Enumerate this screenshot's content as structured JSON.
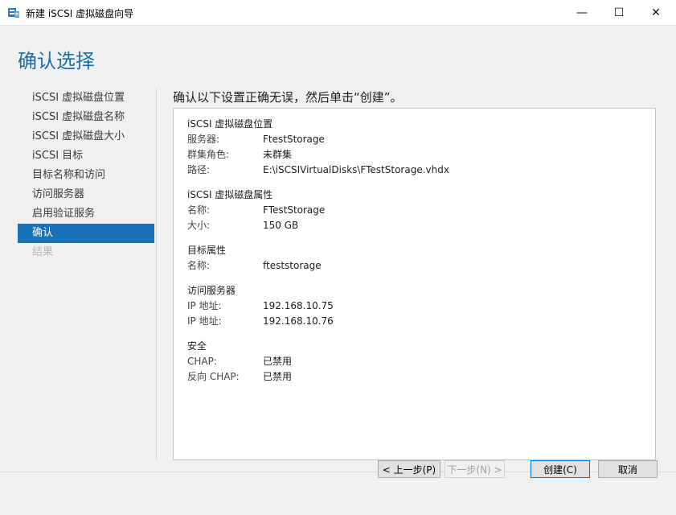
{
  "window": {
    "title": "新建 iSCSI 虚拟磁盘向导",
    "minimize_glyph": "—",
    "maximize_glyph": "☐",
    "close_glyph": "✕"
  },
  "page": {
    "title": "确认选择",
    "instruction": "确认以下设置正确无误，然后单击“创建”。"
  },
  "nav": {
    "items": [
      {
        "label": "iSCSI 虚拟磁盘位置",
        "state": "normal"
      },
      {
        "label": "iSCSI 虚拟磁盘名称",
        "state": "normal"
      },
      {
        "label": "iSCSI 虚拟磁盘大小",
        "state": "normal"
      },
      {
        "label": "iSCSI 目标",
        "state": "normal"
      },
      {
        "label": "目标名称和访问",
        "state": "normal"
      },
      {
        "label": "访问服务器",
        "state": "normal"
      },
      {
        "label": "启用验证服务",
        "state": "normal"
      },
      {
        "label": "确认",
        "state": "active"
      },
      {
        "label": "结果",
        "state": "disabled"
      }
    ]
  },
  "summary": {
    "location": {
      "title": "iSCSI 虚拟磁盘位置",
      "rows": [
        {
          "key": "服务器:",
          "value": "FtestStorage"
        },
        {
          "key": "群集角色:",
          "value": "未群集"
        },
        {
          "key": "路径:",
          "value": "E:\\iSCSIVirtualDisks\\FTestStorage.vhdx"
        }
      ]
    },
    "properties": {
      "title": "iSCSI 虚拟磁盘属性",
      "rows": [
        {
          "key": "名称:",
          "value": "FTestStorage"
        },
        {
          "key": "大小:",
          "value": "150 GB"
        }
      ]
    },
    "target": {
      "title": "目标属性",
      "rows": [
        {
          "key": "名称:",
          "value": "fteststorage"
        }
      ]
    },
    "access": {
      "title": "访问服务器",
      "rows": [
        {
          "key": "IP 地址:",
          "value": "192.168.10.75"
        },
        {
          "key": "IP 地址:",
          "value": "192.168.10.76"
        }
      ]
    },
    "security": {
      "title": "安全",
      "rows": [
        {
          "key": "CHAP:",
          "value": "已禁用"
        },
        {
          "key": "反向 CHAP:",
          "value": "已禁用"
        }
      ]
    }
  },
  "buttons": {
    "previous": "< 上一步(P)",
    "next": "下一步(N) >",
    "create": "创建(C)",
    "cancel": "取消"
  },
  "colors": {
    "accent": "#1a72b8",
    "title_blue": "#1b6ea8"
  }
}
